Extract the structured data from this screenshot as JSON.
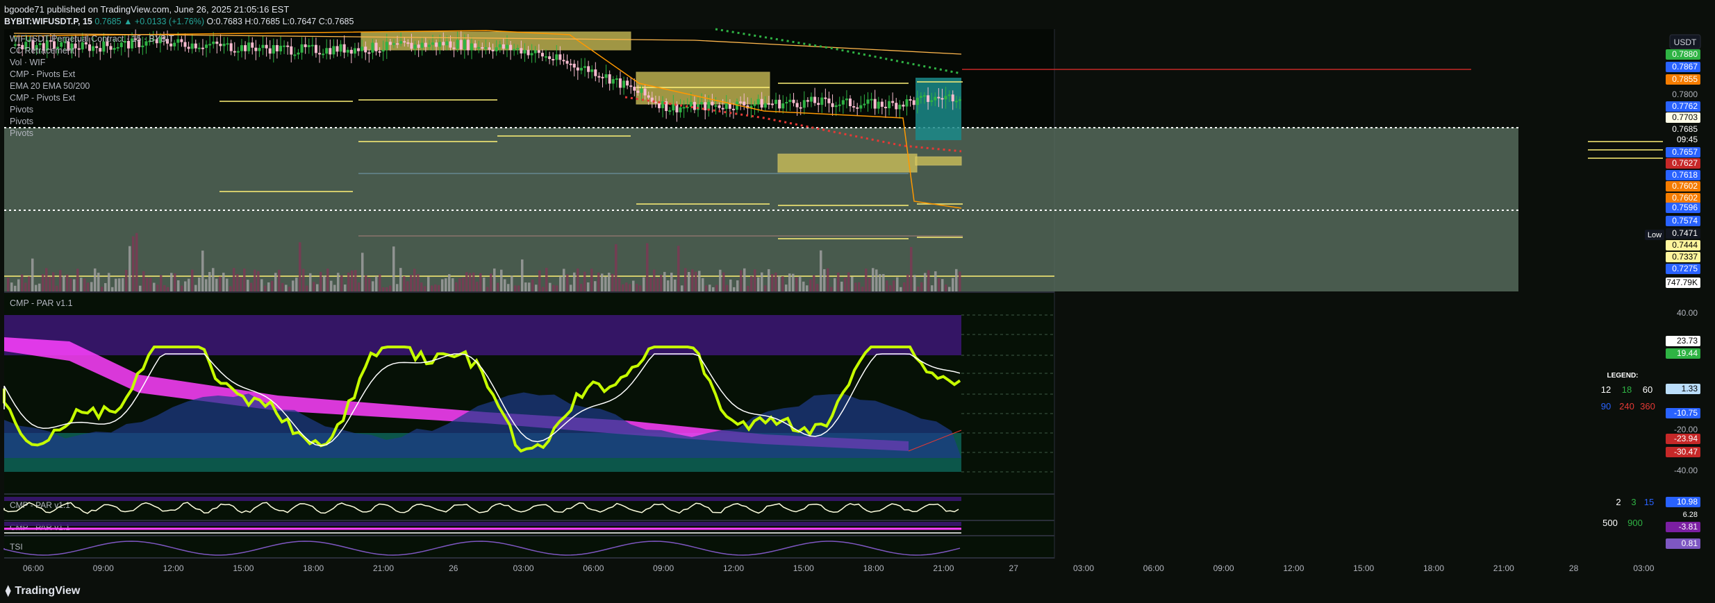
{
  "header": {
    "published": "bgoode71 published on TradingView.com, June 26, 2025 21:05:16 EST",
    "symbol": "BYBIT:WIFUSDT.P, 15",
    "last": "0.7685",
    "change": "▲ +0.0133 (+1.76%)",
    "ohlc": "O:0.7683 H:0.7685 L:0.7647 C:0.7685"
  },
  "currency_button": "USDT",
  "legend_main": [
    "WIFUSDT Perpetual Contract · 15 · BYBIT",
    "CC Retracement",
    "Vol · WIF",
    "CMP - Pivots Ext",
    "EMA 20 EMA 50/200",
    "CMP - Pivots Ext",
    "Pivots",
    "Pivots",
    "Pivots"
  ],
  "price_axis_labels": [
    {
      "text": "0.7880",
      "color": "#2fb344",
      "fg": "#ffffff"
    },
    {
      "text": "0.7867",
      "color": "#2962ff",
      "fg": "#ffffff"
    },
    {
      "text": "0.7855",
      "color": "#f57c00",
      "fg": "#ffffff"
    },
    {
      "text": "0.7800",
      "color": "",
      "fg": "#b2b5be"
    },
    {
      "text": "0.7762",
      "color": "#2962ff",
      "fg": "#ffffff"
    },
    {
      "text": "0.7703",
      "color": "#fffde7",
      "fg": "#000000"
    },
    {
      "text": "0.7685",
      "color": "",
      "fg": "#ffffff"
    },
    {
      "text": "09:45",
      "color": "",
      "fg": "#ffffff"
    },
    {
      "text": "0.7657",
      "color": "#2962ff",
      "fg": "#ffffff"
    },
    {
      "text": "0.7627",
      "color": "#c62828",
      "fg": "#ffffff"
    },
    {
      "text": "0.7618",
      "color": "#2962ff",
      "fg": "#ffffff"
    },
    {
      "text": "0.7602",
      "color": "#f57c00",
      "fg": "#ffffff"
    },
    {
      "text": "0.7602",
      "color": "#f57c00",
      "fg": "#ffffff"
    },
    {
      "text": "0.7596",
      "color": "#2962ff",
      "fg": "#ffffff"
    },
    {
      "text": "0.7574",
      "color": "#2962ff",
      "fg": "#ffffff"
    },
    {
      "text": "0.7471",
      "color": "#131722",
      "fg": "#ffffff"
    },
    {
      "text": "0.7444",
      "color": "#fff59d",
      "fg": "#000000"
    },
    {
      "text": "0.7337",
      "color": "#fff59d",
      "fg": "#000000"
    },
    {
      "text": "0.7275",
      "color": "#2962ff",
      "fg": "#ffffff"
    },
    {
      "text": "747.79K",
      "color": "#ffffff",
      "fg": "#000000"
    }
  ],
  "low_tag": "Low",
  "osc_title": "CMP - PAR v1.1",
  "osc_axis": [
    {
      "text": "40.00",
      "color": "",
      "fg": "#b2b5be"
    },
    {
      "text": "23.73",
      "color": "#ffffff",
      "fg": "#000000"
    },
    {
      "text": "19.44",
      "color": "#2fb344",
      "fg": "#ffffff"
    },
    {
      "text": "1.33",
      "color": "#bbdefb",
      "fg": "#000000"
    },
    {
      "text": "-10.75",
      "color": "#2962ff",
      "fg": "#ffffff"
    },
    {
      "text": "-20.00",
      "color": "",
      "fg": "#b2b5be"
    },
    {
      "text": "-23.94",
      "color": "#c62828",
      "fg": "#ffffff"
    },
    {
      "text": "-30.47",
      "color": "#c62828",
      "fg": "#ffffff"
    },
    {
      "text": "-40.00",
      "color": "",
      "fg": "#b2b5be"
    }
  ],
  "osc_legend": {
    "title": "LEGEND:",
    "row1": [
      "12",
      "18",
      "60"
    ],
    "row2": [
      "90",
      "240",
      "360"
    ]
  },
  "small1": {
    "title": "CMP - PAR v1.1",
    "values": [
      "2",
      "3",
      "15"
    ],
    "axis": [
      "10.98",
      "6.28"
    ]
  },
  "small2": {
    "title": "CMP - PAR v1.1",
    "values": [
      "500",
      "900"
    ],
    "axis": [
      "-3.81"
    ]
  },
  "small3": {
    "title": "TSI",
    "axis": [
      "0.81"
    ]
  },
  "time_axis": [
    "06:00",
    "09:00",
    "12:00",
    "15:00",
    "18:00",
    "21:00",
    "26",
    "03:00",
    "06:00",
    "09:00",
    "12:00",
    "15:00",
    "18:00",
    "21:00",
    "27",
    "03:00",
    "06:00",
    "09:00",
    "12:00",
    "15:00",
    "18:00",
    "21:00",
    "28",
    "03:00"
  ],
  "footer_brand": "TradingView",
  "colors": {
    "bg": "#0b0f0b",
    "up": "#2fb344",
    "down": "#f8bbd0",
    "ema20": "#ff9800",
    "band": "#ff40ff",
    "osc_fast": "#c6ff00",
    "osc_slow": "#ffffff",
    "zone": "#55685a"
  },
  "chart_data": {
    "type": "line",
    "title": "WIFUSDT Perpetual Contract · 15 · BYBIT",
    "xlabel": "",
    "ylabel": "",
    "ylim": [
      0.7275,
      0.788
    ],
    "x": [
      "06:00",
      "09:00",
      "12:00",
      "15:00",
      "18:00",
      "21:00",
      "26",
      "03:00",
      "06:00",
      "09:00",
      "12:00",
      "15:00",
      "18:00",
      "21:00"
    ],
    "series": [
      {
        "name": "Close",
        "values": [
          0.787,
          0.786,
          0.788,
          0.7862,
          0.785,
          0.7858,
          0.7874,
          0.785,
          0.777,
          0.764,
          0.7652,
          0.766,
          0.765,
          0.7685
        ]
      }
    ]
  }
}
